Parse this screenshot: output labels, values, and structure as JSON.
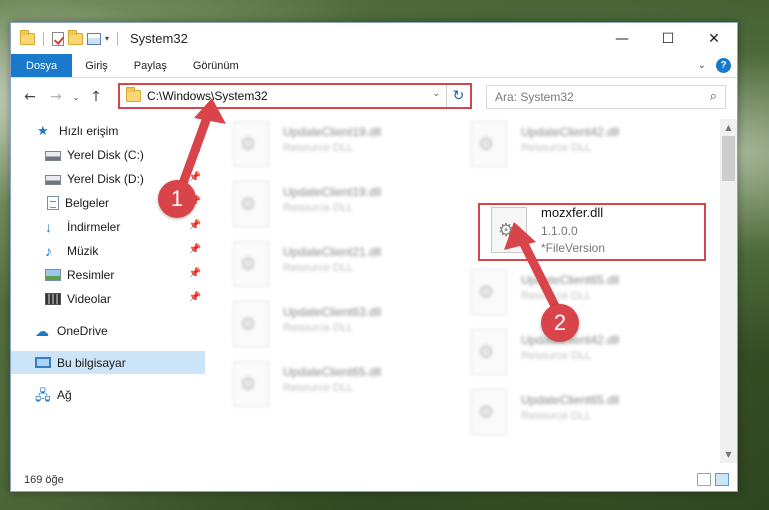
{
  "window": {
    "title": "System32"
  },
  "titlebar": {
    "minimize_glyph": "—",
    "maximize_glyph": "☐",
    "close_glyph": "✕",
    "qa_dropdown_glyph": "▾"
  },
  "ribbon": {
    "tabs": [
      "Dosya",
      "Giriş",
      "Paylaş",
      "Görünüm"
    ],
    "expand_glyph": "⌄",
    "help_glyph": "?"
  },
  "navigation": {
    "back_glyph": "←",
    "forward_glyph": "→",
    "recent_glyph": "⌄",
    "up_glyph": "↑"
  },
  "address": {
    "path": "C:\\Windows\\System32",
    "dropdown_glyph": "⌄",
    "refresh_glyph": "↻"
  },
  "search": {
    "placeholder": "Ara: System32",
    "icon": "search-icon"
  },
  "sidebar": {
    "items": [
      {
        "label": "Hızlı erişim",
        "icon": "star-icon",
        "pinned": false
      },
      {
        "label": "Yerel Disk (C:)",
        "icon": "disk-icon",
        "pinned": true
      },
      {
        "label": "Yerel Disk (D:)",
        "icon": "disk-icon",
        "pinned": true
      },
      {
        "label": "Belgeler",
        "icon": "document-icon",
        "pinned": true
      },
      {
        "label": "İndirmeler",
        "icon": "download-icon",
        "pinned": true
      },
      {
        "label": "Müzik",
        "icon": "music-icon",
        "pinned": true
      },
      {
        "label": "Resimler",
        "icon": "pictures-icon",
        "pinned": true
      },
      {
        "label": "Videolar",
        "icon": "video-icon",
        "pinned": true
      },
      {
        "label": "OneDrive",
        "icon": "cloud-icon",
        "pinned": false
      },
      {
        "label": "Bu bilgisayar",
        "icon": "computer-icon",
        "pinned": false,
        "selected": true
      },
      {
        "label": "Ağ",
        "icon": "network-icon",
        "pinned": false
      }
    ]
  },
  "files": {
    "left_column": [
      {
        "name": "UpdateClient19.dll",
        "type": "Resource DLL"
      },
      {
        "name": "UpdateClient19.dll",
        "type": "Resource DLL"
      },
      {
        "name": "UpdateClient21.dll",
        "type": "Resource DLL"
      },
      {
        "name": "UpdateClient63.dll",
        "type": "Resource DLL"
      },
      {
        "name": "UpdateClient65.dll",
        "type": "Resource DLL"
      }
    ],
    "right_column": [
      {
        "name": "UpdateClient42.dll",
        "type": "Resource DLL"
      },
      {
        "name": "UpdateClient65.dll",
        "type": "Resource DLL"
      },
      {
        "name": "UpdateClient42.dll",
        "type": "Resource DLL"
      },
      {
        "name": "UpdateClient65.dll",
        "type": "Resource DLL"
      }
    ],
    "highlighted": {
      "name": "mozxfer.dll",
      "version": "1.1.0.0",
      "description": "*FileVersion"
    }
  },
  "status": {
    "item_count": "169 öğe"
  },
  "annotations": {
    "badge_1": "1",
    "badge_2": "2",
    "color": "#d9434a"
  }
}
